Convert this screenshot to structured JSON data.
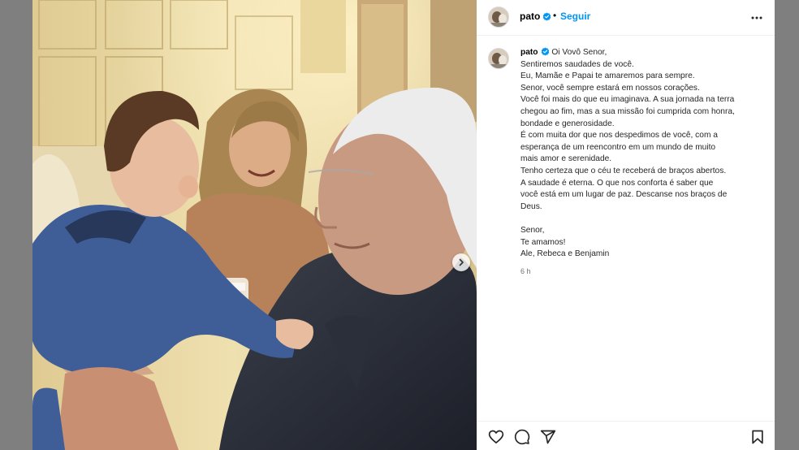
{
  "header": {
    "username": "pato",
    "separator": "•",
    "follow_label": "Seguir",
    "more_icon": "more-horizontal-icon"
  },
  "caption": {
    "username": "pato",
    "lines": [
      "Oi Vovô Senor,",
      "Sentiremos saudades de você.",
      "Eu, Mamãe e Papai te amaremos para sempre.",
      "Senor, você sempre estará em nossos corações.",
      "Você foi mais do que eu imaginava. A sua jornada na terra",
      "chegou ao fim, mas a sua missão foi cumprida com honra,",
      "bondade e generosidade.",
      "É com muita dor que nos despedimos de você, com a",
      "esperança de um reencontro em um mundo de muito",
      "mais amor e serenidade.",
      "Tenho certeza que o céu te receberá de braços abertos.",
      "A saudade é eterna. O que nos conforta é saber que",
      "você está em um lugar de paz. Descanse nos braços de",
      "Deus."
    ],
    "closing": [
      "Senor,",
      "Te amamos!",
      "Ale, Rebeca e Benjamin"
    ],
    "timestamp": "6 h"
  },
  "media": {
    "next_icon": "chevron-right-icon"
  },
  "actions": {
    "like_icon": "heart-icon",
    "comment_icon": "comment-icon",
    "share_icon": "share-icon",
    "save_icon": "bookmark-icon"
  },
  "colors": {
    "accent": "#0095f6",
    "verified": "#0095f6",
    "text": "#262626",
    "muted": "#737373",
    "backdrop": "#7f7f7f"
  }
}
